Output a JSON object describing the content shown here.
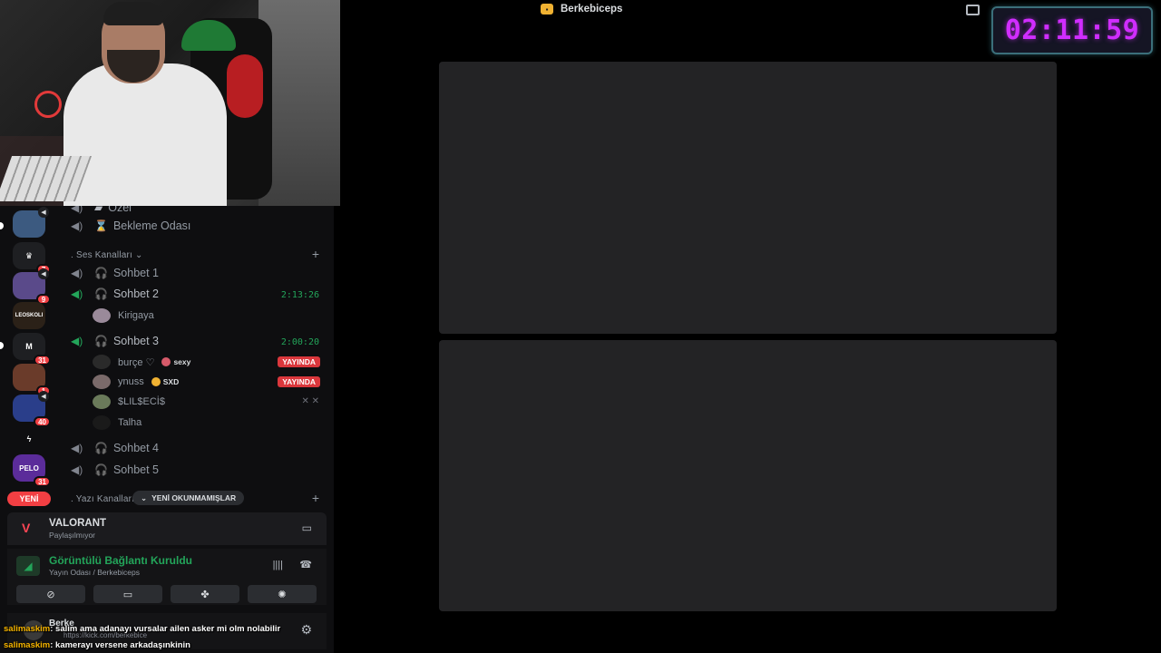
{
  "top_bar": {
    "server_name": "Berkebiceps"
  },
  "countdown": "02:11:59",
  "server_rail": [
    {
      "label": "",
      "badge": "",
      "color": "#3c5a80"
    },
    {
      "label": "♛",
      "badge": "7",
      "color": "#1e1f22"
    },
    {
      "label": "",
      "badge": "9",
      "color": "#5a4a8a"
    },
    {
      "label": "LEOSKOLI",
      "badge": "",
      "color": "#2b2118"
    },
    {
      "label": "M",
      "badge": "31",
      "color": "#1e1f22"
    },
    {
      "label": "",
      "badge": "1",
      "color": "#6a3b2a"
    },
    {
      "label": "",
      "badge": "40",
      "color": "#2a3e8a"
    },
    {
      "label": "ϟ",
      "badge": "",
      "color": "#1e1f22"
    },
    {
      "label": "PELO",
      "badge": "31",
      "color": "#5b2c9a"
    }
  ],
  "new_pill": "YENİ",
  "channels": {
    "top_partial": "Özel",
    "waiting_room": "Bekleme Odası",
    "voice_category": ". Ses Kanalları",
    "text_category": ". Yazı Kanalları",
    "unread_jump": "YENİ OKUNMAMIŞLAR",
    "sohbet1": "Sohbet 1",
    "sohbet2": "Sohbet 2",
    "sohbet2_timer": "2:13:26",
    "sohbet2_users": [
      {
        "name": "Kirigaya"
      }
    ],
    "sohbet3": "Sohbet 3",
    "sohbet3_timer": "2:00:20",
    "sohbet3_users": [
      {
        "name": "burçe ♡",
        "tag": "sexy",
        "live": "YAYINDA"
      },
      {
        "name": "ynuss",
        "tag": "SXD",
        "live": "YAYINDA"
      },
      {
        "name": "$LIL$ECİ$"
      },
      {
        "name": "Talha"
      }
    ],
    "sohbet4": "Sohbet 4",
    "sohbet5": "Sohbet 5"
  },
  "activity": {
    "game": "VALORANT",
    "status": "Paylaşılmıyor"
  },
  "voice_connection": {
    "title": "Görüntülü Bağlantı Kuruldu",
    "subtitle": "Yayın Odası / Berkebiceps"
  },
  "user_panel": {
    "name": "Berke",
    "status": "https://kick.com/berkebice"
  },
  "chat": [
    {
      "user": "salimaskim",
      "message": ": salim ama adanayı vursalar ailen asker mi olm nolabilir"
    },
    {
      "user": "salimaskim",
      "message": ": kamerayı versene arkadaşınkinin"
    }
  ]
}
